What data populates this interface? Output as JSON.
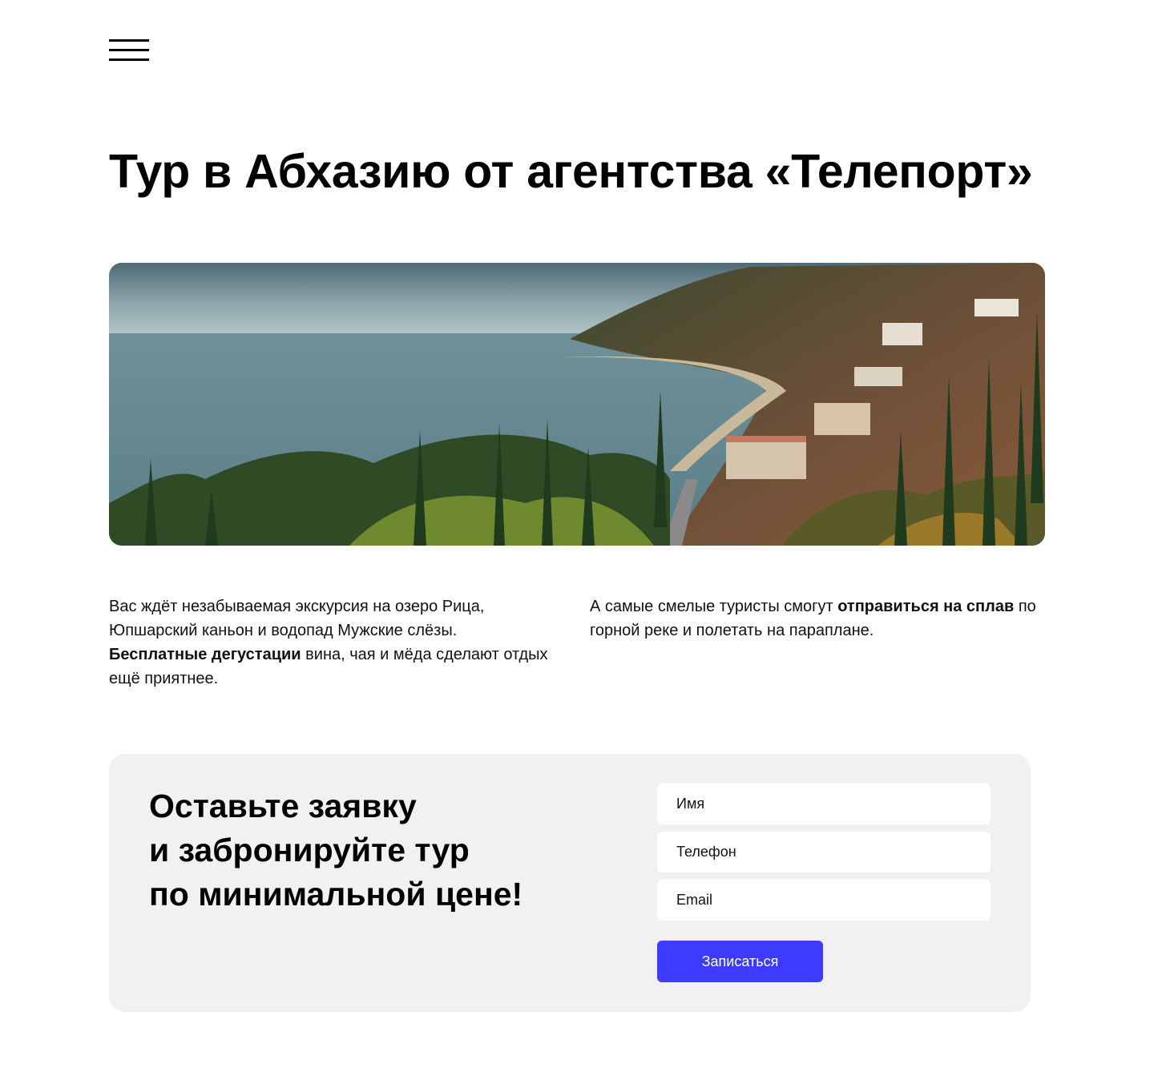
{
  "header": {
    "menu_icon": "hamburger-menu-icon"
  },
  "page": {
    "title": "Тур в Абхазию от агентства «Телепорт»"
  },
  "hero": {
    "image": "coastal-landscape-photo"
  },
  "intro": {
    "left": {
      "part1": "Вас ждёт незабываемая экскурсия на озеро Рица, Юпшарский каньон и водопад Мужские слёзы. ",
      "bold": "Бесплатные дегустации",
      "part2": " вина, чая и мёда сделают отдых ещё приятнее."
    },
    "right": {
      "part1": "А самые смелые туристы смогут ",
      "bold": "отправиться на сплав",
      "part2": " по горной реке и полетать на параплане."
    }
  },
  "booking": {
    "title_line1": "Оставьте заявку",
    "title_line2": "и забронируйте тур",
    "title_line3": "по минимальной цене!",
    "name_placeholder": "Имя",
    "phone_placeholder": "Телефон",
    "email_placeholder": "Email",
    "submit_label": "Записаться",
    "accent_color": "#3d3bff",
    "panel_color": "#f1f1f1"
  }
}
